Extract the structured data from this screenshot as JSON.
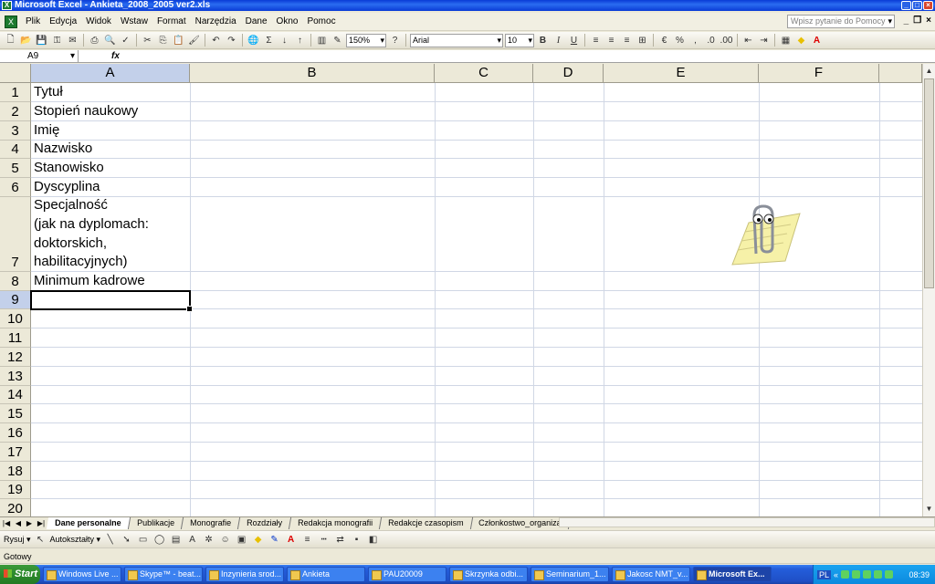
{
  "window": {
    "title": "Microsoft Excel - Ankieta_2008_2005 ver2.xls"
  },
  "menu": {
    "items": [
      "Plik",
      "Edycja",
      "Widok",
      "Wstaw",
      "Format",
      "Narzędzia",
      "Dane",
      "Okno",
      "Pomoc"
    ],
    "ask_placeholder": "Wpisz pytanie do Pomocy"
  },
  "toolbar": {
    "zoom": "150%",
    "font": "Arial",
    "size": "10",
    "percent": "%",
    "sigma": "Σ"
  },
  "formula_bar": {
    "name_box": "A9",
    "fx": "fx",
    "content": ""
  },
  "columns": [
    "A",
    "B",
    "C",
    "D",
    "E",
    "F"
  ],
  "rows": [
    "1",
    "2",
    "3",
    "4",
    "5",
    "6",
    "7",
    "8",
    "9",
    "10",
    "11",
    "12",
    "13",
    "14",
    "15",
    "16",
    "17",
    "18",
    "19",
    "20"
  ],
  "cells": {
    "a1": "Tytuł",
    "a2": "Stopień naukowy",
    "a3": "Imię",
    "a4": "Nazwisko",
    "a5": "Stanowisko",
    "a6": "Dyscyplina",
    "a7_l1": "Specjalność",
    "a7_l2": "(jak na dyplomach:",
    "a7_l3": "doktorskich,",
    "a7_l4": "habilitacyjnych)",
    "a8": "Minimum kadrowe"
  },
  "sheets": [
    "Dane personalne",
    "Publikacje",
    "Monografie",
    "Rozdziały",
    "Redakcja monografii",
    "Redakcje czasopism",
    "Członkostwo_organiza"
  ],
  "drawing": {
    "draw": "Rysuj ▾",
    "autoshapes": "Autokształty ▾"
  },
  "status": "Gotowy",
  "taskbar": {
    "start": "Start",
    "tasks": [
      "Windows Live ...",
      "Skype™ - beat...",
      "Inzynieria srod...",
      "Ankieta",
      "PAU20009",
      "Skrzynka odbi...",
      "Seminarium_1...",
      "Jakosc NMT_v...",
      "Microsoft Ex..."
    ],
    "lang": "PL",
    "clock": "08:39"
  }
}
